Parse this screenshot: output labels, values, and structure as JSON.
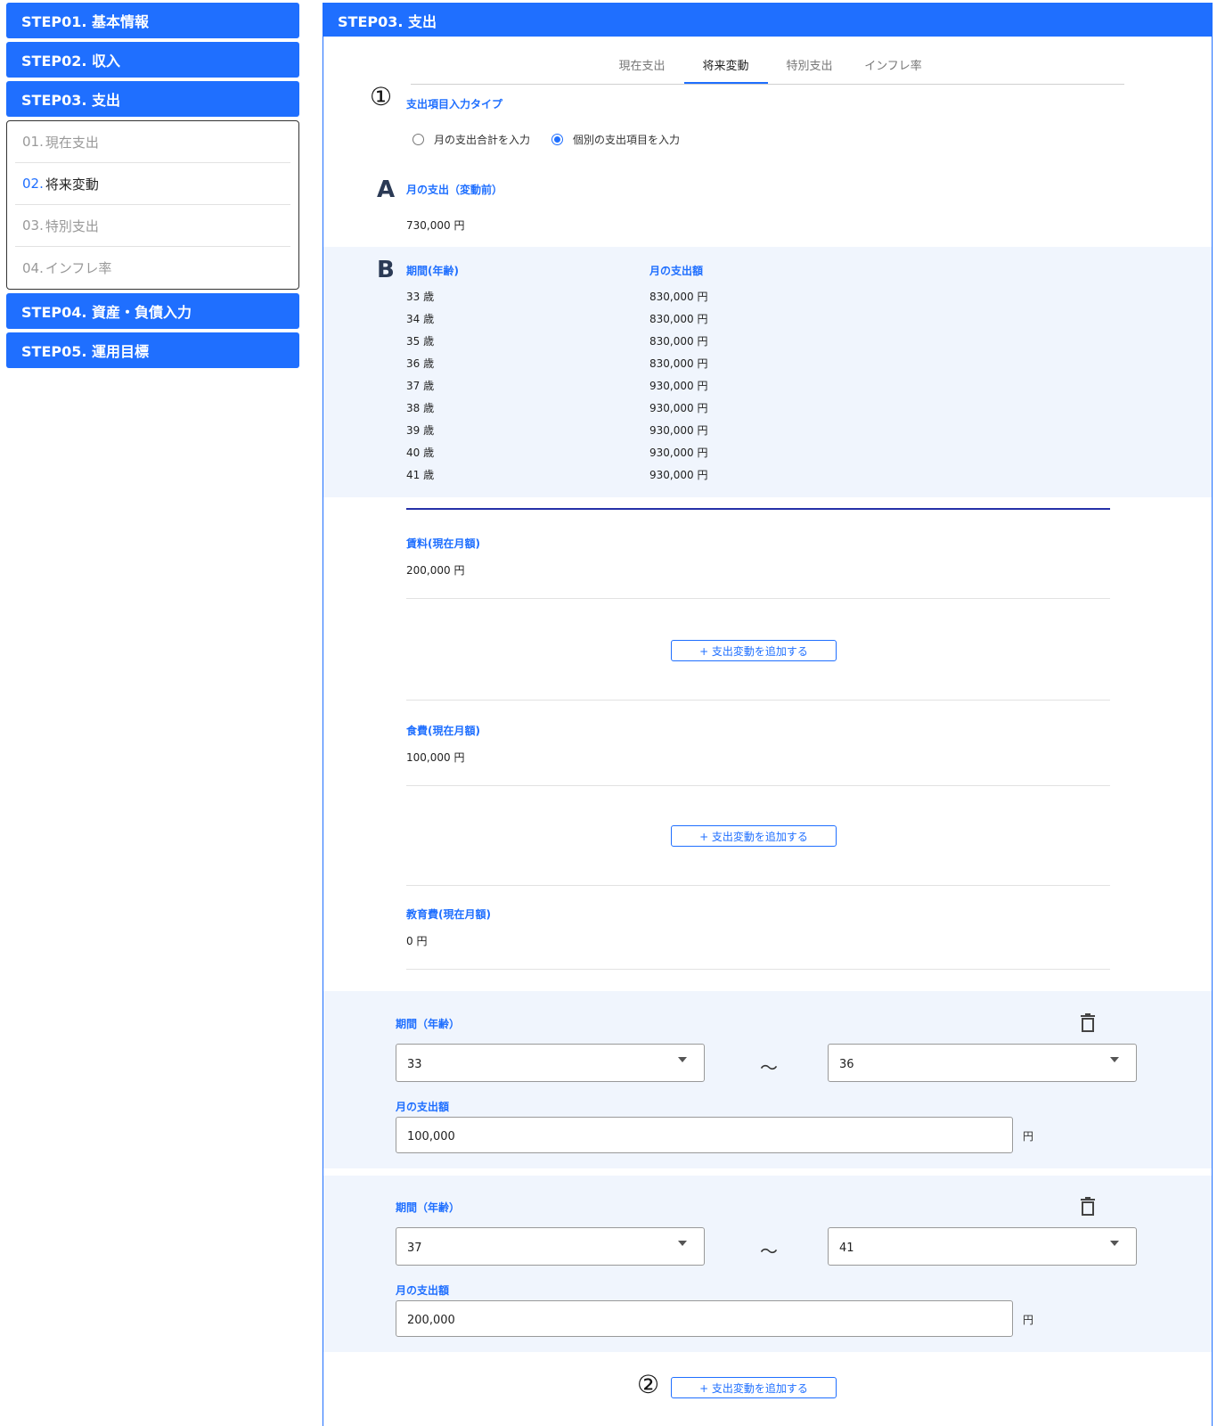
{
  "sidebar": {
    "steps_top": [
      "STEP01. 基本情報",
      "STEP02. 収入",
      "STEP03. 支出"
    ],
    "substeps": [
      {
        "num": "01.",
        "label": "現在支出"
      },
      {
        "num": "02.",
        "label": "将来変動"
      },
      {
        "num": "03.",
        "label": "特別支出"
      },
      {
        "num": "04.",
        "label": "インフレ率"
      }
    ],
    "steps_bottom": [
      "STEP04. 資産・負債入力",
      "STEP05. 運用目標"
    ]
  },
  "panel": {
    "title": "STEP03. 支出",
    "tabs": [
      "現在支出",
      "将来変動",
      "特別支出",
      "インフレ率"
    ],
    "markers": {
      "one": "①",
      "two": "②",
      "a": "A",
      "b": "B"
    },
    "input_type": {
      "label": "支出項目入力タイプ",
      "options": [
        "月の支出合計を入力",
        "個別の支出項目を入力"
      ],
      "selected": "個別の支出項目を入力"
    },
    "monthly_before": {
      "label": "月の支出（変動前）",
      "value": "730,000 円"
    },
    "schedule": {
      "col_period": "期間(年齢)",
      "col_amount": "月の支出額",
      "rows": [
        {
          "age": "33 歳",
          "amount": "830,000 円"
        },
        {
          "age": "34 歳",
          "amount": "830,000 円"
        },
        {
          "age": "35 歳",
          "amount": "830,000 円"
        },
        {
          "age": "36 歳",
          "amount": "830,000 円"
        },
        {
          "age": "37 歳",
          "amount": "930,000 円"
        },
        {
          "age": "38 歳",
          "amount": "930,000 円"
        },
        {
          "age": "39 歳",
          "amount": "930,000 円"
        },
        {
          "age": "40 歳",
          "amount": "930,000 円"
        },
        {
          "age": "41 歳",
          "amount": "930,000 円"
        }
      ]
    },
    "items": [
      {
        "label": "賃料(現在月額)",
        "value": "200,000 円"
      },
      {
        "label": "食費(現在月額)",
        "value": "100,000 円"
      },
      {
        "label": "教育費(現在月額)",
        "value": "0 円"
      }
    ],
    "add_change_label": "+ 支出変動を追加する",
    "changes": [
      {
        "period_label": "期間（年齢）",
        "from": "33",
        "tilde": "〜",
        "to": "36",
        "amount_label": "月の支出額",
        "amount": "100,000",
        "unit": "円"
      },
      {
        "period_label": "期間（年齢）",
        "from": "37",
        "tilde": "〜",
        "to": "41",
        "amount_label": "月の支出額",
        "amount": "200,000",
        "unit": "円"
      }
    ]
  }
}
